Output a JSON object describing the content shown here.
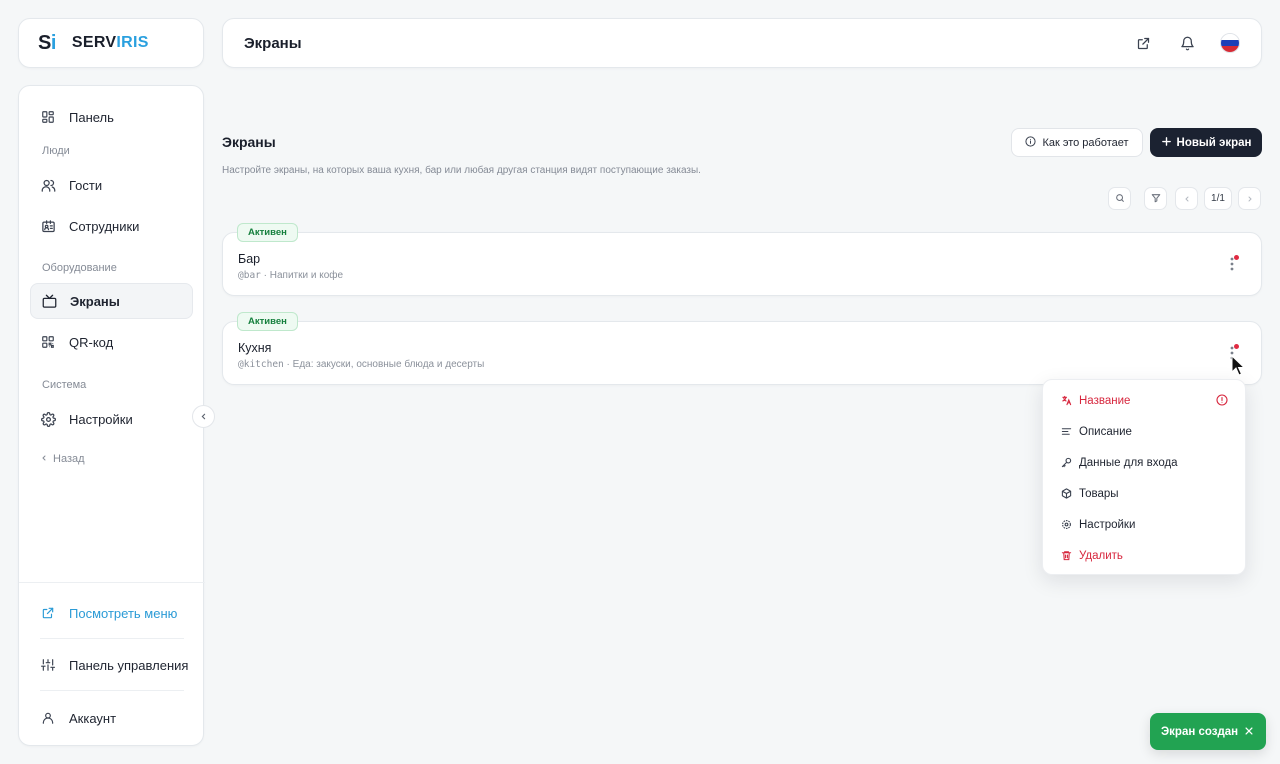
{
  "brand": {
    "mark_s": "S",
    "mark_i": "i",
    "word_a": "SERV",
    "word_b": "IRIS"
  },
  "header": {
    "title": "Экраны",
    "flag_colors": [
      "#ffffff",
      "#1c3fb8",
      "#d62b35"
    ]
  },
  "sidebar": {
    "items": [
      {
        "label": "Панель",
        "icon": "dashboard-icon"
      },
      {
        "label": "Гости",
        "icon": "users-icon"
      },
      {
        "label": "Сотрудники",
        "icon": "id-card-icon"
      },
      {
        "label": "Экраны",
        "icon": "tv-icon",
        "active": true
      },
      {
        "label": "QR-код",
        "icon": "qr-code-icon"
      },
      {
        "label": "Настройки",
        "icon": "gear-icon"
      }
    ],
    "sections": [
      "Люди",
      "Оборудование",
      "Система"
    ],
    "back_label": "Назад",
    "bottom": {
      "view_menu": "Посмотреть меню",
      "control_panel": "Панель управления",
      "account": "Аккаунт"
    }
  },
  "main": {
    "title": "Экраны",
    "subtitle": "Настройте экраны, на которых ваша кухня, бар или любая другая станция видят поступающие заказы.",
    "how_it_works": "Как это работает",
    "new_screen": "Новый экран",
    "pager": "1/1",
    "screens": [
      {
        "status": "Активен",
        "name": "Бар",
        "code": "@bar",
        "description": " · Напитки и кофе"
      },
      {
        "status": "Активен",
        "name": "Кухня",
        "code": "@kitchen",
        "description": " · Еда: закуски, основные блюда и десерты"
      }
    ]
  },
  "menu": {
    "items": [
      {
        "label": "Название",
        "icon": "translate-icon",
        "danger": true
      },
      {
        "label": "Описание",
        "icon": "text-lines-icon"
      },
      {
        "label": "Данные для входа",
        "icon": "key-icon"
      },
      {
        "label": "Товары",
        "icon": "box-icon"
      },
      {
        "label": "Настройки",
        "icon": "gear-icon"
      },
      {
        "label": "Удалить",
        "icon": "trash-icon",
        "danger": true
      }
    ]
  },
  "toast": {
    "message": "Экран создан"
  },
  "colors": {
    "accent": "#2aa0df",
    "primary_dark": "#1b2231",
    "success": "#22a352",
    "danger": "#d7263d"
  }
}
